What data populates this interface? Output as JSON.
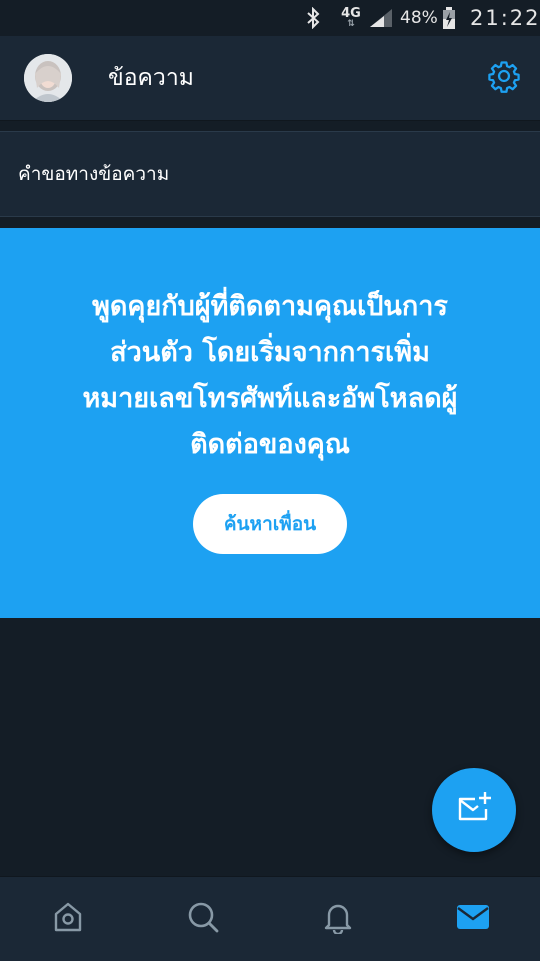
{
  "status_bar": {
    "network": "4G",
    "battery": "48%",
    "time": "21:22"
  },
  "header": {
    "title": "ข้อความ",
    "avatar_icon": "user-avatar",
    "settings_icon": "gear-icon"
  },
  "request_row": {
    "label": "คำขอทางข้อความ"
  },
  "promo": {
    "lines": [
      "พูดคุยกับผู้ที่ติดตามคุณเป็นการ",
      "ส่วนตัว โดยเริ่มจากการเพิ่ม",
      "หมายเลขโทรศัพท์และอัพโหลดผู้",
      "ติดต่อของคุณ"
    ],
    "button_label": "ค้นหาเพื่อน"
  },
  "fab": {
    "icon": "new-message-icon"
  },
  "bottom_nav": {
    "items": [
      {
        "icon": "home-icon",
        "active": false
      },
      {
        "icon": "search-icon",
        "active": false
      },
      {
        "icon": "bell-icon",
        "active": false
      },
      {
        "icon": "mail-icon",
        "active": true
      }
    ]
  },
  "colors": {
    "accent": "#1da1f2",
    "background": "#141d26",
    "surface": "#1b2836",
    "icon_inactive": "#8899a6"
  }
}
